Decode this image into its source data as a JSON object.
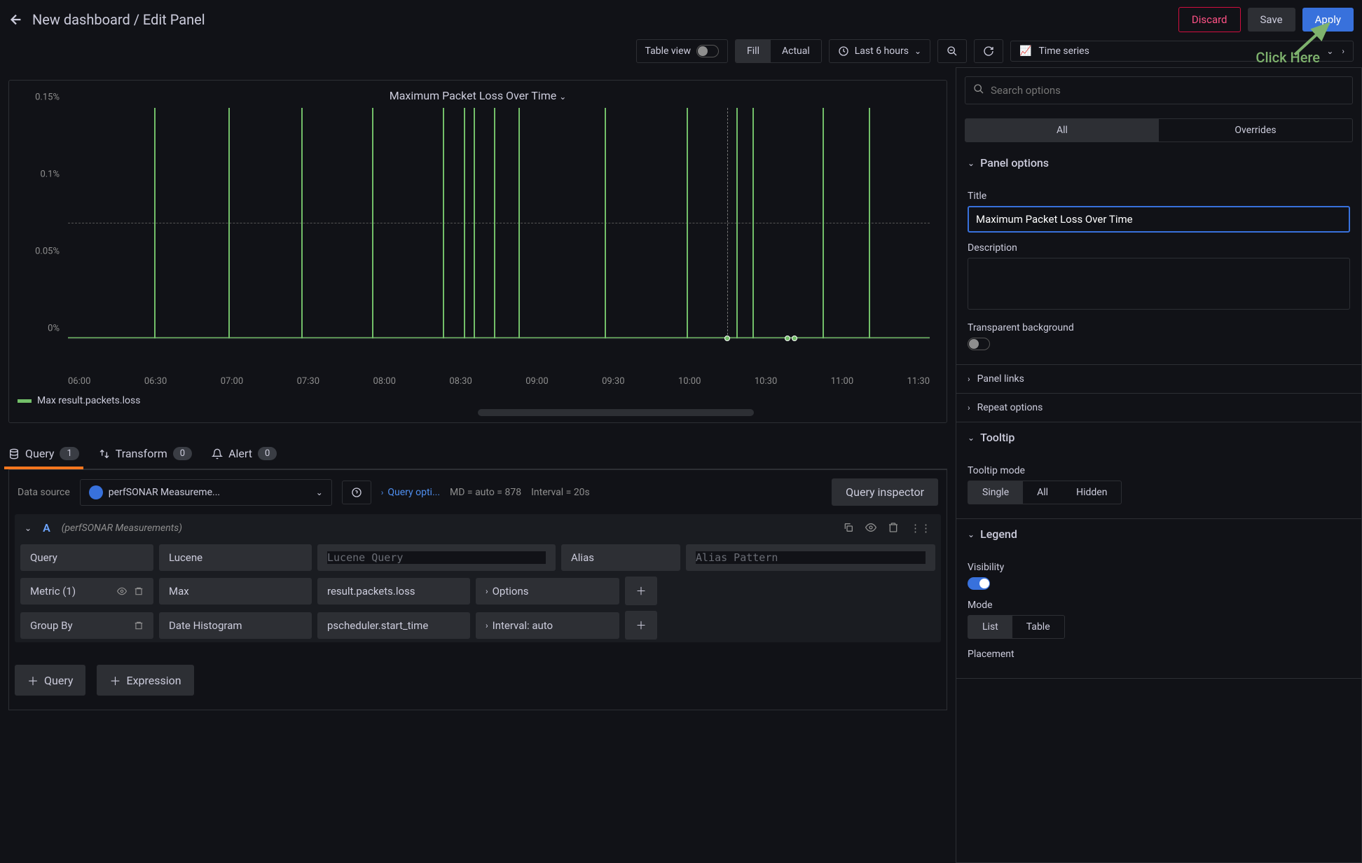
{
  "header": {
    "breadcrumb": "New dashboard / Edit Panel",
    "discard": "Discard",
    "save": "Save",
    "apply": "Apply"
  },
  "toolbar": {
    "table_view": "Table view",
    "fill": "Fill",
    "actual": "Actual",
    "time_range": "Last 6 hours",
    "viz_type": "Time series"
  },
  "annotation": {
    "click_here": "Click Here"
  },
  "panel": {
    "title": "Maximum Packet Loss Over Time",
    "legend": "Max result.packets.loss"
  },
  "chart_data": {
    "type": "bar",
    "title": "Maximum Packet Loss Over Time",
    "ylabel": "",
    "xlabel": "",
    "ylim": [
      0,
      0.17
    ],
    "y_ticks": [
      "0%",
      "0.05%",
      "0.1%",
      "0.15%"
    ],
    "x_ticks": [
      "06:00",
      "06:30",
      "07:00",
      "07:30",
      "08:00",
      "08:30",
      "09:00",
      "09:30",
      "10:00",
      "10:30",
      "11:00",
      "11:30"
    ],
    "reference_line": 0.085,
    "series": [
      {
        "name": "Max result.packets.loss",
        "spikes": [
          {
            "x_pct": 10.0,
            "value_pct": 0.17
          },
          {
            "x_pct": 18.6,
            "value_pct": 0.17
          },
          {
            "x_pct": 27.1,
            "value_pct": 0.17
          },
          {
            "x_pct": 35.3,
            "value_pct": 0.17
          },
          {
            "x_pct": 43.5,
            "value_pct": 0.17
          },
          {
            "x_pct": 45.9,
            "value_pct": 0.17
          },
          {
            "x_pct": 47.1,
            "value_pct": 0.17
          },
          {
            "x_pct": 49.4,
            "value_pct": 0.17
          },
          {
            "x_pct": 52.3,
            "value_pct": 0.17
          },
          {
            "x_pct": 62.3,
            "value_pct": 0.17
          },
          {
            "x_pct": 71.8,
            "value_pct": 0.17
          },
          {
            "x_pct": 77.6,
            "value_pct": 0.17
          },
          {
            "x_pct": 79.4,
            "value_pct": 0.17
          },
          {
            "x_pct": 87.6,
            "value_pct": 0.17
          },
          {
            "x_pct": 92.9,
            "value_pct": 0.17
          }
        ],
        "markers": [
          {
            "x_pct": 76.5,
            "y_val": 0
          },
          {
            "x_pct": 83.5,
            "y_val": 0
          },
          {
            "x_pct": 84.3,
            "y_val": 0
          }
        ],
        "cursor_x_pct": 76.5
      }
    ]
  },
  "tabs": {
    "query": "Query",
    "query_count": "1",
    "transform": "Transform",
    "transform_count": "0",
    "alert": "Alert",
    "alert_count": "0"
  },
  "ds": {
    "label": "Data source",
    "selected": "perfSONAR Measureme...",
    "query_options": "Query opti...",
    "md": "MD = auto = 878",
    "interval": "Interval = 20s",
    "inspector": "Query inspector"
  },
  "query_a": {
    "letter": "A",
    "ds_hint": "(perfSONAR Measurements)",
    "query_label": "Query",
    "lucene": "Lucene",
    "lucene_placeholder": "Lucene Query",
    "alias_label": "Alias",
    "alias_placeholder": "Alias Pattern",
    "metric_label": "Metric (1)",
    "metric_fn": "Max",
    "metric_field": "result.packets.loss",
    "options": "Options",
    "groupby_label": "Group By",
    "groupby_fn": "Date Histogram",
    "groupby_field": "pscheduler.start_time",
    "interval_opt": "Interval: auto"
  },
  "add": {
    "query": "Query",
    "expression": "Expression"
  },
  "options_panel": {
    "search_placeholder": "Search options",
    "all": "All",
    "overrides": "Overrides",
    "panel_options": "Panel options",
    "title_label": "Title",
    "title_value": "Maximum Packet Loss Over Time",
    "desc_label": "Description",
    "transparent": "Transparent background",
    "panel_links": "Panel links",
    "repeat": "Repeat options",
    "tooltip": "Tooltip",
    "tooltip_mode": "Tooltip mode",
    "tooltip_single": "Single",
    "tooltip_all": "All",
    "tooltip_hidden": "Hidden",
    "legend": "Legend",
    "visibility": "Visibility",
    "mode": "Mode",
    "mode_list": "List",
    "mode_table": "Table",
    "placement": "Placement"
  }
}
